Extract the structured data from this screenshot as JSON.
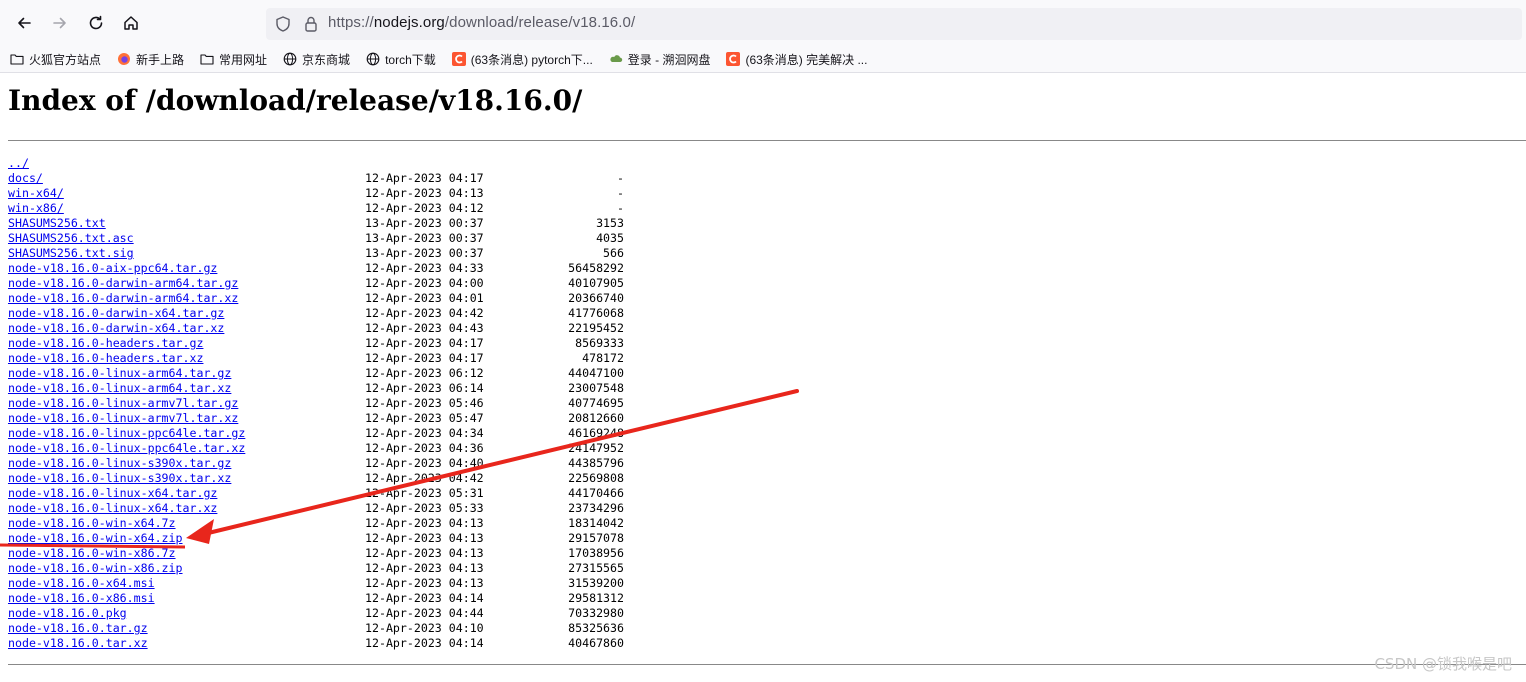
{
  "browser": {
    "url_prefix": "https://",
    "url_host": "nodejs.org",
    "url_path": "/download/release/v18.16.0/"
  },
  "bookmarks": [
    {
      "label": "火狐官方站点",
      "icon": "folder-icon"
    },
    {
      "label": "新手上路",
      "icon": "firefox-icon"
    },
    {
      "label": "常用网址",
      "icon": "folder-icon"
    },
    {
      "label": "京东商城",
      "icon": "globe-icon"
    },
    {
      "label": "torch下载",
      "icon": "globe-icon"
    },
    {
      "label": "(63条消息) pytorch下...",
      "icon": "csdn-icon"
    },
    {
      "label": "登录 - 溯洄网盘",
      "icon": "cloud-icon"
    },
    {
      "label": "(63条消息) 完美解决 ...",
      "icon": "csdn-icon"
    }
  ],
  "page": {
    "heading": "Index of /download/release/v18.16.0/",
    "entries": [
      {
        "name": "../",
        "date": "",
        "size": ""
      },
      {
        "name": "docs/",
        "date": "12-Apr-2023 04:17",
        "size": "-"
      },
      {
        "name": "win-x64/",
        "date": "12-Apr-2023 04:13",
        "size": "-"
      },
      {
        "name": "win-x86/",
        "date": "12-Apr-2023 04:12",
        "size": "-"
      },
      {
        "name": "SHASUMS256.txt",
        "date": "13-Apr-2023 00:37",
        "size": "3153"
      },
      {
        "name": "SHASUMS256.txt.asc",
        "date": "13-Apr-2023 00:37",
        "size": "4035"
      },
      {
        "name": "SHASUMS256.txt.sig",
        "date": "13-Apr-2023 00:37",
        "size": "566"
      },
      {
        "name": "node-v18.16.0-aix-ppc64.tar.gz",
        "date": "12-Apr-2023 04:33",
        "size": "56458292"
      },
      {
        "name": "node-v18.16.0-darwin-arm64.tar.gz",
        "date": "12-Apr-2023 04:00",
        "size": "40107905"
      },
      {
        "name": "node-v18.16.0-darwin-arm64.tar.xz",
        "date": "12-Apr-2023 04:01",
        "size": "20366740"
      },
      {
        "name": "node-v18.16.0-darwin-x64.tar.gz",
        "date": "12-Apr-2023 04:42",
        "size": "41776068"
      },
      {
        "name": "node-v18.16.0-darwin-x64.tar.xz",
        "date": "12-Apr-2023 04:43",
        "size": "22195452"
      },
      {
        "name": "node-v18.16.0-headers.tar.gz",
        "date": "12-Apr-2023 04:17",
        "size": "8569333"
      },
      {
        "name": "node-v18.16.0-headers.tar.xz",
        "date": "12-Apr-2023 04:17",
        "size": "478172"
      },
      {
        "name": "node-v18.16.0-linux-arm64.tar.gz",
        "date": "12-Apr-2023 06:12",
        "size": "44047100"
      },
      {
        "name": "node-v18.16.0-linux-arm64.tar.xz",
        "date": "12-Apr-2023 06:14",
        "size": "23007548"
      },
      {
        "name": "node-v18.16.0-linux-armv7l.tar.gz",
        "date": "12-Apr-2023 05:46",
        "size": "40774695"
      },
      {
        "name": "node-v18.16.0-linux-armv7l.tar.xz",
        "date": "12-Apr-2023 05:47",
        "size": "20812660"
      },
      {
        "name": "node-v18.16.0-linux-ppc64le.tar.gz",
        "date": "12-Apr-2023 04:34",
        "size": "46169248"
      },
      {
        "name": "node-v18.16.0-linux-ppc64le.tar.xz",
        "date": "12-Apr-2023 04:36",
        "size": "24147952"
      },
      {
        "name": "node-v18.16.0-linux-s390x.tar.gz",
        "date": "12-Apr-2023 04:40",
        "size": "44385796"
      },
      {
        "name": "node-v18.16.0-linux-s390x.tar.xz",
        "date": "12-Apr-2023 04:42",
        "size": "22569808"
      },
      {
        "name": "node-v18.16.0-linux-x64.tar.gz",
        "date": "12-Apr-2023 05:31",
        "size": "44170466"
      },
      {
        "name": "node-v18.16.0-linux-x64.tar.xz",
        "date": "12-Apr-2023 05:33",
        "size": "23734296"
      },
      {
        "name": "node-v18.16.0-win-x64.7z",
        "date": "12-Apr-2023 04:13",
        "size": "18314042"
      },
      {
        "name": "node-v18.16.0-win-x64.zip",
        "date": "12-Apr-2023 04:13",
        "size": "29157078"
      },
      {
        "name": "node-v18.16.0-win-x86.7z",
        "date": "12-Apr-2023 04:13",
        "size": "17038956"
      },
      {
        "name": "node-v18.16.0-win-x86.zip",
        "date": "12-Apr-2023 04:13",
        "size": "27315565"
      },
      {
        "name": "node-v18.16.0-x64.msi",
        "date": "12-Apr-2023 04:13",
        "size": "31539200"
      },
      {
        "name": "node-v18.16.0-x86.msi",
        "date": "12-Apr-2023 04:14",
        "size": "29581312"
      },
      {
        "name": "node-v18.16.0.pkg",
        "date": "12-Apr-2023 04:44",
        "size": "70332980"
      },
      {
        "name": "node-v18.16.0.tar.gz",
        "date": "12-Apr-2023 04:10",
        "size": "85325636"
      },
      {
        "name": "node-v18.16.0.tar.xz",
        "date": "12-Apr-2023 04:14",
        "size": "40467860"
      }
    ]
  },
  "annotation": {
    "color": "#e8261c",
    "highlighted_entry": "node-v18.16.0-win-x64.zip"
  },
  "watermark": "CSDN @锁我喉是吧"
}
